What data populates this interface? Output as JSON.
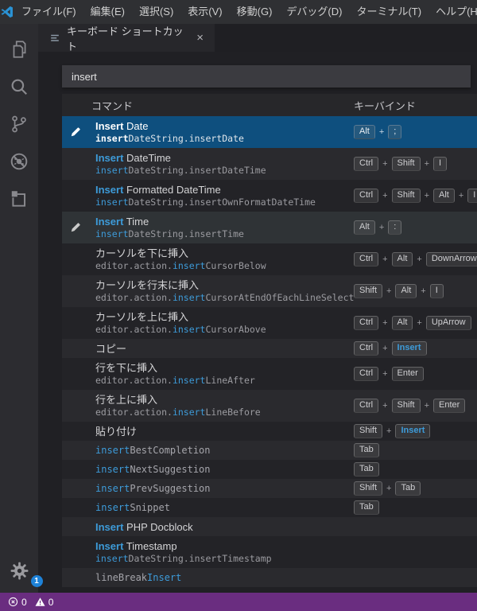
{
  "window": {
    "menu": [
      "ファイル(F)",
      "編集(E)",
      "選択(S)",
      "表示(V)",
      "移動(G)",
      "デバッグ(D)",
      "ターミナル(T)",
      "ヘルプ(H)"
    ]
  },
  "tab": {
    "title": "キーボード ショートカット",
    "close_glyph": "×"
  },
  "search": {
    "value": "insert"
  },
  "activity_bar": {
    "icons": [
      "explorer",
      "search",
      "source-control",
      "debug",
      "extensions"
    ],
    "manage_badge": "1"
  },
  "table": {
    "header": {
      "command": "コマンド",
      "keybinding": "キーバインド"
    },
    "plus": "+",
    "rows": [
      {
        "size": "tall",
        "state": "selected",
        "pencil": true,
        "label": [
          {
            "t": "Insert",
            "m": true
          },
          {
            "t": " Date"
          }
        ],
        "id": [
          {
            "t": "insert",
            "m": true
          },
          {
            "t": "DateString.insertDate"
          }
        ],
        "keys": [
          {
            "t": "Alt"
          },
          {
            "t": ";"
          }
        ]
      },
      {
        "size": "tall",
        "label": [
          {
            "t": "Insert",
            "m": true
          },
          {
            "t": " DateTime"
          }
        ],
        "id": [
          {
            "t": "insert",
            "m": true
          },
          {
            "t": "DateString.insertDateTime"
          }
        ],
        "keys": [
          {
            "t": "Ctrl"
          },
          {
            "t": "Shift"
          },
          {
            "t": "I"
          }
        ]
      },
      {
        "size": "tall",
        "label": [
          {
            "t": "Insert",
            "m": true
          },
          {
            "t": " Formatted DateTime"
          }
        ],
        "id": [
          {
            "t": "insert",
            "m": true
          },
          {
            "t": "DateString.insertOwnFormatDateTime"
          }
        ],
        "keys": [
          {
            "t": "Ctrl"
          },
          {
            "t": "Shift"
          },
          {
            "t": "Alt"
          },
          {
            "t": "I"
          }
        ]
      },
      {
        "size": "tall",
        "state": "hover",
        "pencil": true,
        "label": [
          {
            "t": "Insert",
            "m": true
          },
          {
            "t": " Time"
          }
        ],
        "id": [
          {
            "t": "insert",
            "m": true
          },
          {
            "t": "DateString.insertTime"
          }
        ],
        "keys": [
          {
            "t": "Alt"
          },
          {
            "t": ":"
          }
        ]
      },
      {
        "size": "tall",
        "label": [
          {
            "t": "カーソルを下に挿入"
          }
        ],
        "id": [
          {
            "t": "editor.action."
          },
          {
            "t": "insert",
            "m": true
          },
          {
            "t": "CursorBelow"
          }
        ],
        "keys": [
          {
            "t": "Ctrl"
          },
          {
            "t": "Alt"
          },
          {
            "t": "DownArrow"
          }
        ]
      },
      {
        "size": "tall",
        "label": [
          {
            "t": "カーソルを行末に挿入"
          }
        ],
        "id": [
          {
            "t": "editor.action."
          },
          {
            "t": "insert",
            "m": true
          },
          {
            "t": "CursorAtEndOfEachLineSelected"
          }
        ],
        "keys": [
          {
            "t": "Shift"
          },
          {
            "t": "Alt"
          },
          {
            "t": "I"
          }
        ]
      },
      {
        "size": "tall",
        "label": [
          {
            "t": "カーソルを上に挿入"
          }
        ],
        "id": [
          {
            "t": "editor.action."
          },
          {
            "t": "insert",
            "m": true
          },
          {
            "t": "CursorAbove"
          }
        ],
        "keys": [
          {
            "t": "Ctrl"
          },
          {
            "t": "Alt"
          },
          {
            "t": "UpArrow"
          }
        ]
      },
      {
        "size": "short",
        "label": [
          {
            "t": "コピー"
          }
        ],
        "keys": [
          {
            "t": "Ctrl"
          },
          {
            "t": "Insert",
            "m": true
          }
        ]
      },
      {
        "size": "tall",
        "label": [
          {
            "t": "行を下に挿入"
          }
        ],
        "id": [
          {
            "t": "editor.action."
          },
          {
            "t": "insert",
            "m": true
          },
          {
            "t": "LineAfter"
          }
        ],
        "keys": [
          {
            "t": "Ctrl"
          },
          {
            "t": "Enter"
          }
        ]
      },
      {
        "size": "tall",
        "label": [
          {
            "t": "行を上に挿入"
          }
        ],
        "id": [
          {
            "t": "editor.action."
          },
          {
            "t": "insert",
            "m": true
          },
          {
            "t": "LineBefore"
          }
        ],
        "keys": [
          {
            "t": "Ctrl"
          },
          {
            "t": "Shift"
          },
          {
            "t": "Enter"
          }
        ]
      },
      {
        "size": "short",
        "label": [
          {
            "t": "貼り付け"
          }
        ],
        "keys": [
          {
            "t": "Shift"
          },
          {
            "t": "Insert",
            "m": true
          }
        ]
      },
      {
        "size": "short",
        "mono": true,
        "label": [
          {
            "t": "insert",
            "m": true
          },
          {
            "t": "BestCompletion"
          }
        ],
        "keys": [
          {
            "t": "Tab"
          }
        ]
      },
      {
        "size": "short",
        "mono": true,
        "label": [
          {
            "t": "insert",
            "m": true
          },
          {
            "t": "NextSuggestion"
          }
        ],
        "keys": [
          {
            "t": "Tab"
          }
        ]
      },
      {
        "size": "short",
        "mono": true,
        "label": [
          {
            "t": "insert",
            "m": true
          },
          {
            "t": "PrevSuggestion"
          }
        ],
        "keys": [
          {
            "t": "Shift"
          },
          {
            "t": "Tab"
          }
        ]
      },
      {
        "size": "short",
        "mono": true,
        "label": [
          {
            "t": "insert",
            "m": true
          },
          {
            "t": "Snippet"
          }
        ],
        "keys": [
          {
            "t": "Tab"
          }
        ]
      },
      {
        "size": "short",
        "label": [
          {
            "t": "Insert",
            "m": true
          },
          {
            "t": " PHP Docblock"
          }
        ],
        "keys": []
      },
      {
        "size": "tall",
        "label": [
          {
            "t": "Insert",
            "m": true
          },
          {
            "t": " Timestamp"
          }
        ],
        "id": [
          {
            "t": "insert",
            "m": true
          },
          {
            "t": "DateString.insertTimestamp"
          }
        ],
        "keys": []
      },
      {
        "size": "short",
        "mono": true,
        "label": [
          {
            "t": "lineBreak"
          },
          {
            "t": "Insert",
            "m": true
          }
        ],
        "keys": []
      }
    ]
  },
  "status_bar": {
    "error_count": "0",
    "warning_count": "0"
  },
  "colors": {
    "selection": "#0e4f7e",
    "match": "#3d9bd9",
    "status_bar": "#6a2d80",
    "badge": "#1e82d8"
  }
}
